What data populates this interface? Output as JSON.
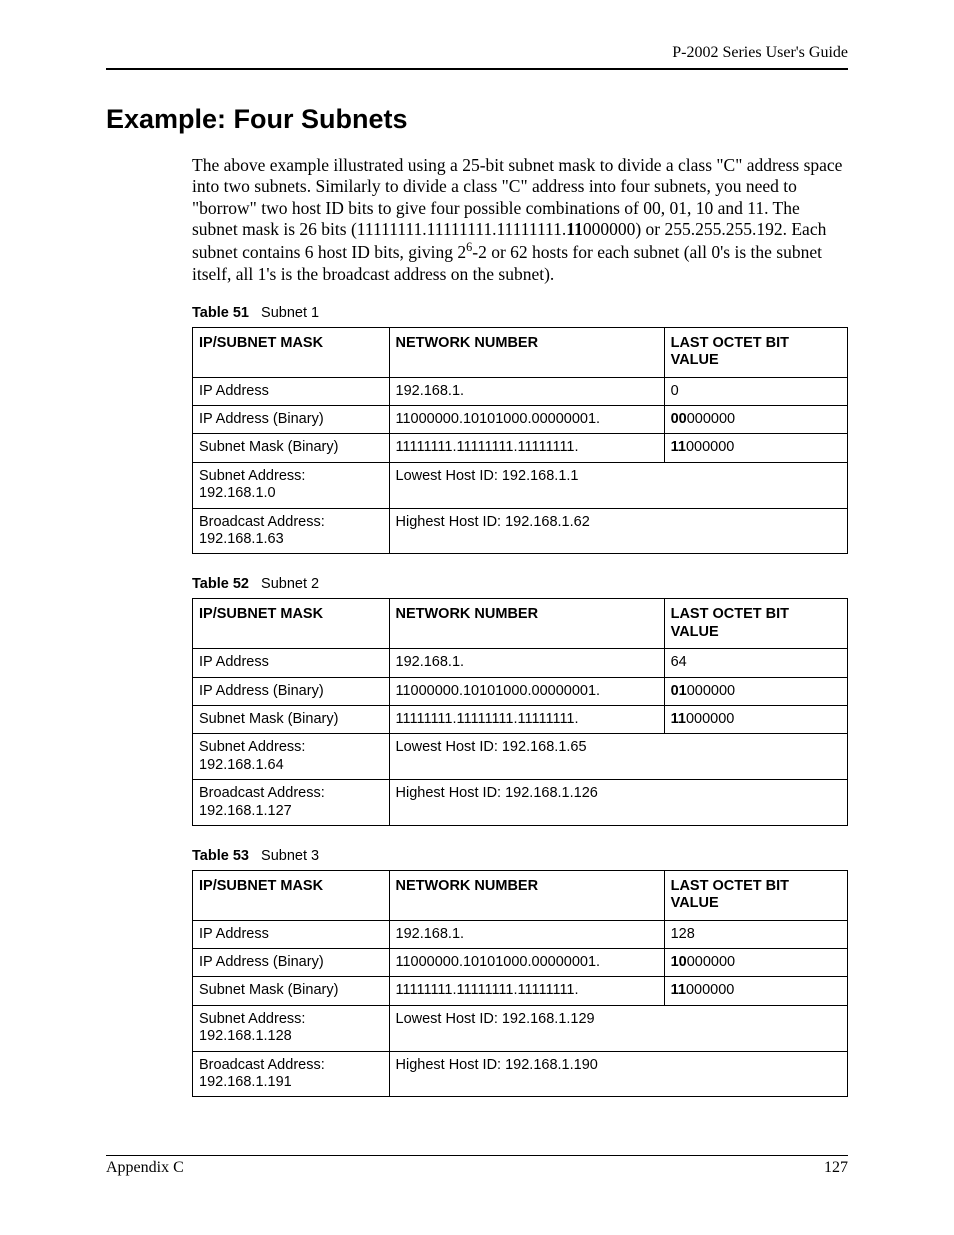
{
  "header": {
    "guide": "P-2002 Series User's Guide"
  },
  "heading": "Example: Four Subnets",
  "paragraph": {
    "t1": "The above example illustrated using a 25-bit subnet mask to divide a class \"C\" address space into two subnets. Similarly to divide a class \"C\" address into four subnets, you need to \"borrow\" two host ID bits to give four possible combinations of 00, 01, 10 and 11. The subnet mask is 26 bits (11111111.11111111.11111111.",
    "mask_bold": "11",
    "t2": "000000) or 255.255.255.192. Each subnet contains 6 host ID bits, giving 2",
    "exp": "6",
    "t3": "-2 or 62 hosts for each subnet (all 0's is the subnet itself, all 1's is the broadcast address on the subnet)."
  },
  "table_labels": {
    "col_a": "IP/SUBNET MASK",
    "col_b": "NETWORK NUMBER",
    "col_c": "LAST OCTET BIT VALUE",
    "ip_address": "IP Address",
    "ip_binary": "IP Address (Binary)",
    "mask_binary": "Subnet Mask (Binary)"
  },
  "tables": {
    "t51": {
      "caption_label": "Table 51",
      "caption_text": "Subnet 1",
      "ip_address": "192.168.1.",
      "ip_last": "0",
      "ip_bin": "11000000.10101000.00000001.",
      "ip_bin_last_bold": "00",
      "ip_bin_last_rest": "000000",
      "mask_bin": "11111111.11111111.11111111.",
      "mask_bin_last_bold": "11",
      "mask_bin_last_rest": "000000",
      "subnet_addr": "Subnet Address: 192.168.1.0",
      "lowest": "Lowest Host ID: 192.168.1.1",
      "bcast": "Broadcast Address: 192.168.1.63",
      "highest": "Highest Host ID: 192.168.1.62"
    },
    "t52": {
      "caption_label": "Table 52",
      "caption_text": "Subnet 2",
      "ip_address": "192.168.1.",
      "ip_last": "64",
      "ip_bin": "11000000.10101000.00000001.",
      "ip_bin_last_bold": "01",
      "ip_bin_last_rest": "000000",
      "mask_bin": "11111111.11111111.11111111.",
      "mask_bin_last_bold": "11",
      "mask_bin_last_rest": "000000",
      "subnet_addr": "Subnet Address: 192.168.1.64",
      "lowest": "Lowest Host ID: 192.168.1.65",
      "bcast": "Broadcast Address: 192.168.1.127",
      "highest": "Highest Host ID: 192.168.1.126"
    },
    "t53": {
      "caption_label": "Table 53",
      "caption_text": "Subnet 3",
      "ip_address": "192.168.1.",
      "ip_last": "128",
      "ip_bin": "11000000.10101000.00000001.",
      "ip_bin_last_bold": "10",
      "ip_bin_last_rest": "000000",
      "mask_bin": "11111111.11111111.11111111.",
      "mask_bin_last_bold": "11",
      "mask_bin_last_rest": "000000",
      "subnet_addr": "Subnet Address: 192.168.1.128",
      "lowest": "Lowest Host ID: 192.168.1.129",
      "bcast": "Broadcast Address: 192.168.1.191",
      "highest": "Highest Host ID: 192.168.1.190"
    }
  },
  "footer": {
    "left": "Appendix C",
    "right": "127"
  }
}
